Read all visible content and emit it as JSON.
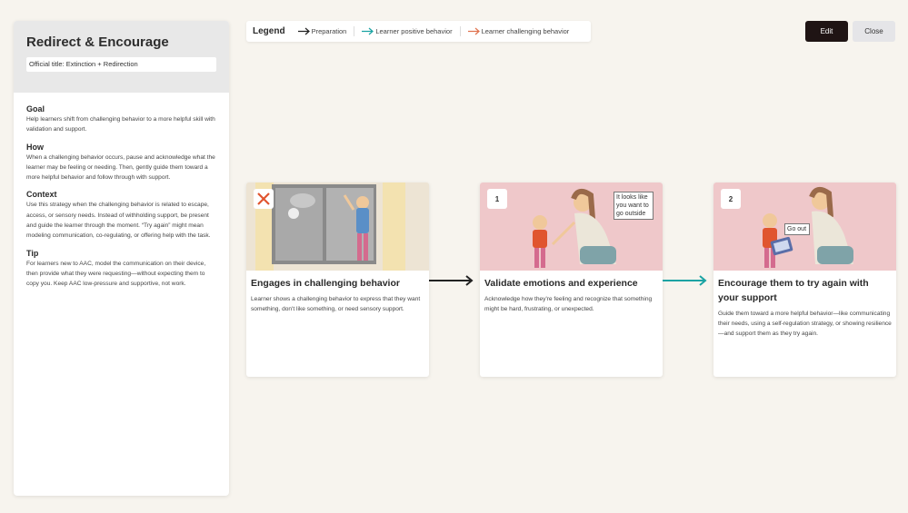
{
  "panel": {
    "title": "Redirect & Encourage",
    "official_title": "Official title: Extinction + Redirection",
    "sections": [
      {
        "heading": "Goal",
        "text": "Help learners shift from challenging behavior to a more helpful skill with validation and support."
      },
      {
        "heading": "How",
        "text": "When a challenging behavior occurs, pause and acknowledge what the learner may be feeling or needing. Then, gently guide them toward a more helpful behavior and follow through with support."
      },
      {
        "heading": "Context",
        "text": "Use this strategy when the challenging behavior is related to escape, access, or sensory needs. Instead of withholding support, be present and guide the learner through the moment. “Try again” might mean modeling communication, co-regulating, or offering help with the task."
      },
      {
        "heading": "Tip",
        "text": "For learners new to  AAC, model the communication on their device, then provide what they were requesting—without expecting them to copy you.  Keep AAC low-pressure and supportive, not work."
      }
    ]
  },
  "legend": {
    "title": "Legend",
    "items": [
      {
        "label": "Preparation",
        "color": "#222222"
      },
      {
        "label": "Learner positive behavior",
        "color": "#1aa3a3"
      },
      {
        "label": "Learner challenging behavior",
        "color": "#e0734f"
      }
    ]
  },
  "buttons": {
    "edit": "Edit",
    "close": "Close"
  },
  "cards": [
    {
      "badge": "",
      "title": "Engages in challenging behavior",
      "description": "Learner shows a challenging behavior to express that they want something, don't like something, or need sensory support.",
      "bubble": ""
    },
    {
      "badge": "1",
      "title": "Validate emotions and experience",
      "description": "Acknowledge how they're feeling and recognize that something might be hard, frustrating, or unexpected.",
      "bubble": "It looks like you want to go outside"
    },
    {
      "badge": "2",
      "title": "Encourage them to try again with your support",
      "description": "Guide them toward a more helpful behavior—like communicating their needs, using a self-regulation strategy, or showing resilience—and support them as they try again.",
      "bubble": "Go out"
    }
  ],
  "colors": {
    "arrow_preparation": "#222222",
    "arrow_positive": "#1aa3a3",
    "card_image_bg": "#efc8ca",
    "badge_x": "#e0552f"
  }
}
